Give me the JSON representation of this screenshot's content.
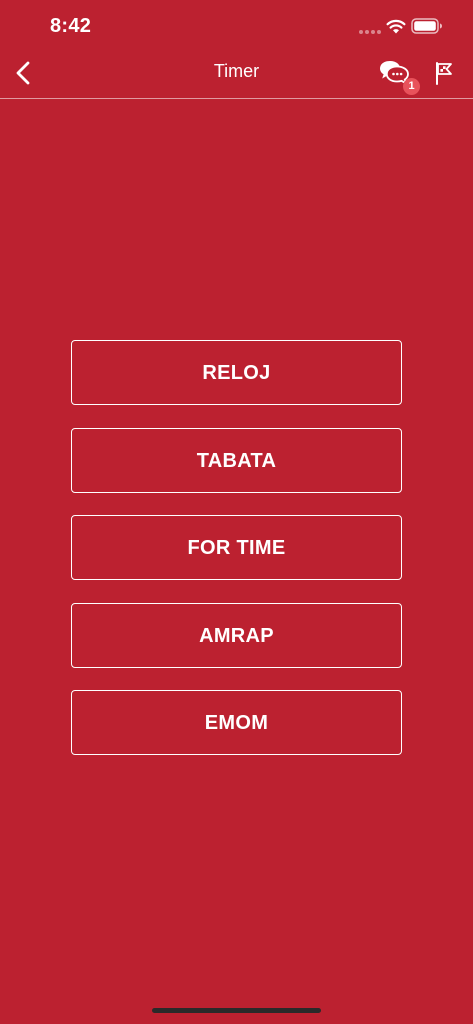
{
  "status_bar": {
    "time": "8:42"
  },
  "nav": {
    "title": "Timer",
    "chat_badge_count": "1"
  },
  "modes": [
    {
      "label": "RELOJ"
    },
    {
      "label": "TABATA"
    },
    {
      "label": "FOR TIME"
    },
    {
      "label": "AMRAP"
    },
    {
      "label": "EMOM"
    }
  ],
  "theme": {
    "background": "#bc2130",
    "foreground": "#ffffff",
    "badge": "#e8525b"
  },
  "icons": {
    "back": "chevron-left-icon",
    "chat": "chat-bubbles-icon",
    "flag": "flag-icon",
    "wifi": "wifi-icon",
    "battery": "battery-icon"
  }
}
